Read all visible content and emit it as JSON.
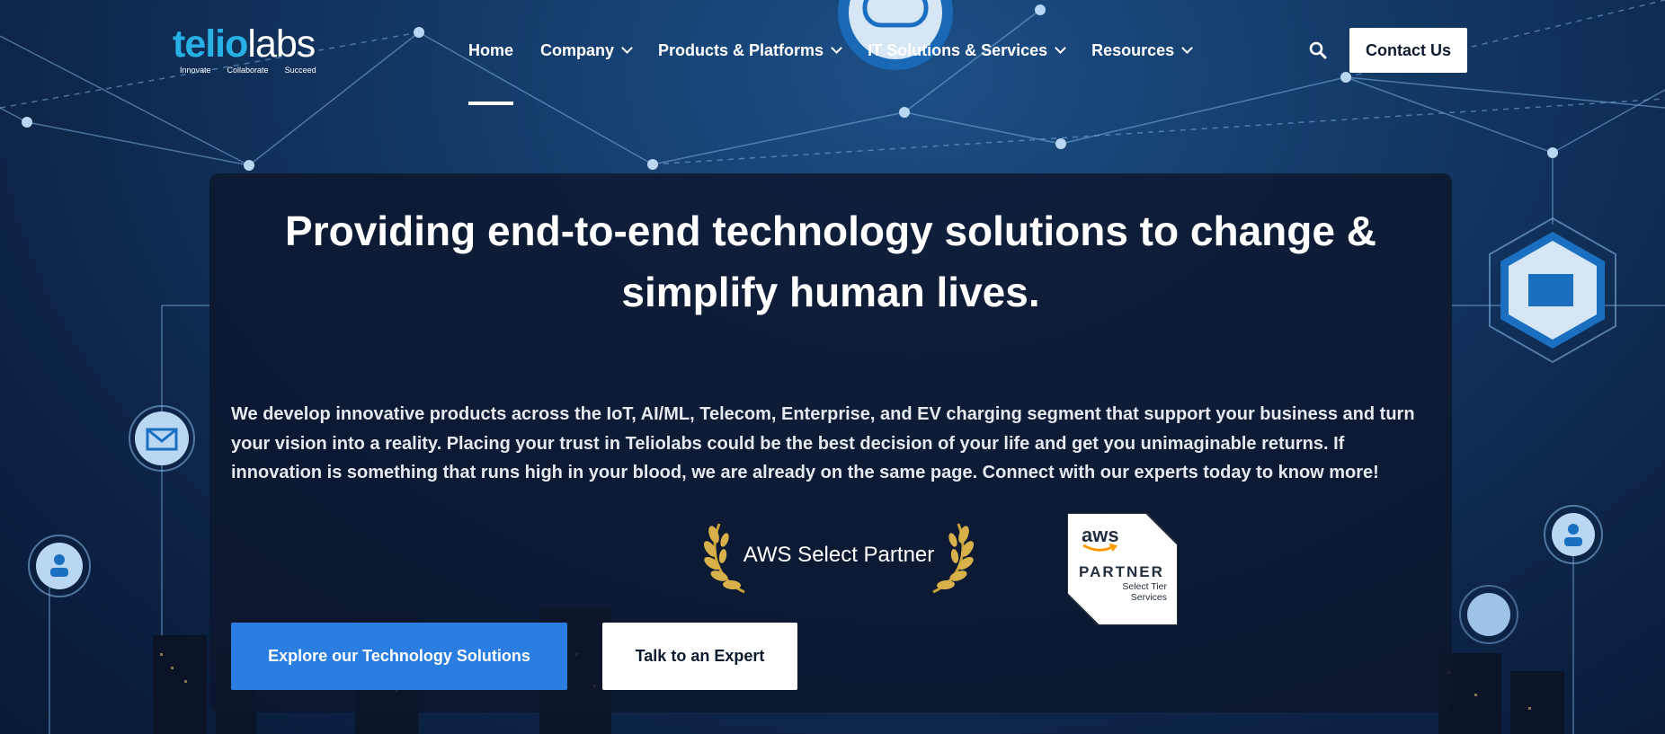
{
  "brand": {
    "logo_part1": "telio",
    "logo_part2": "labs",
    "tagline": [
      "Innovate",
      "Collaborate",
      "Succeed"
    ]
  },
  "nav": {
    "items": [
      {
        "label": "Home",
        "active": true,
        "dropdown": false
      },
      {
        "label": "Company",
        "dropdown": true
      },
      {
        "label": "Products & Platforms",
        "dropdown": true
      },
      {
        "label": "IT Solutions & Services",
        "dropdown": true
      },
      {
        "label": "Resources",
        "dropdown": true
      }
    ],
    "contact_label": "Contact Us"
  },
  "hero": {
    "title": "Providing end-to-end technology solutions to change & simplify human lives.",
    "description": "We develop innovative products across the IoT, AI/ML, Telecom, Enterprise, and EV charging segment that support your business and turn your vision into a reality. Placing your trust in Teliolabs could be the best decision of your life and get you unimaginable returns. If innovation is something that runs high in your blood, we are already on the same page. Connect with our experts today to know more!",
    "award_text": "AWS Select Partner",
    "badge": {
      "logo": "aws",
      "partner": "PARTNER",
      "tier_line1": "Select Tier",
      "tier_line2": "Services"
    },
    "primary_button": "Explore our Technology Solutions",
    "secondary_button": "Talk to an Expert"
  },
  "colors": {
    "accent": "#2a7de1",
    "logo_blue": "#27b0e6",
    "background": "#143a68",
    "panel": "#0e162c"
  }
}
